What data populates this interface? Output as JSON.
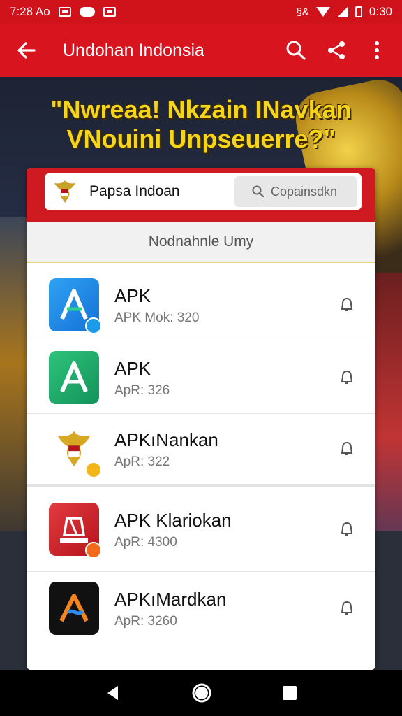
{
  "status_bar": {
    "time": "7:28 Ao",
    "clock": "0:30",
    "icons": [
      "square-icon",
      "cloud-icon",
      "square-icon",
      "bluetooth-icon",
      "wifi-icon",
      "signal-icon",
      "battery-icon"
    ],
    "bt_glyph": "§&"
  },
  "app_bar": {
    "title": "Undohan Indonsia",
    "back_icon": "arrow-left-icon",
    "actions": [
      "search-icon",
      "share-icon",
      "more-vert-icon"
    ]
  },
  "banner": {
    "headline_line1": "\"Nwreaa! Nkzain INavkan",
    "headline_line2": "VNouini Unpseuerre?\""
  },
  "card": {
    "header": {
      "logo": "garuda-emblem-icon",
      "label": "Papsa Indoan",
      "search_button": "Copainsdkn"
    },
    "section_title": "Nodnahnle Umy",
    "items": [
      {
        "name": "APK",
        "sub": "APK Mok: 320",
        "icon": "app-icon-blue-a",
        "icon_color": "#1a8fe6",
        "badge_color": "#1e9be8"
      },
      {
        "name": "APK",
        "sub": "ApR: 326",
        "icon": "app-icon-green-a",
        "icon_color": "#1fae6a",
        "badge_color": ""
      },
      {
        "name": "APKıNankan",
        "sub": "ApR: 322",
        "icon": "garuda-emblem-icon",
        "icon_color": "#ffffff",
        "badge_color": "#f2b61a"
      },
      {
        "name": "APK Klariokan",
        "sub": "ApR: 4300",
        "icon": "app-icon-red-p",
        "icon_color": "#d8262e",
        "badge_color": "#f26a1b"
      },
      {
        "name": "APKıMardkan",
        "sub": "ApR: 3260",
        "icon": "app-icon-black-a",
        "icon_color": "#111111",
        "badge_color": ""
      }
    ]
  },
  "nav_bar": {
    "buttons": [
      "back-triangle-icon",
      "home-circle-icon",
      "recents-square-icon"
    ]
  },
  "colors": {
    "primary_red": "#d8141e",
    "headline_yellow": "#f4d51c"
  }
}
